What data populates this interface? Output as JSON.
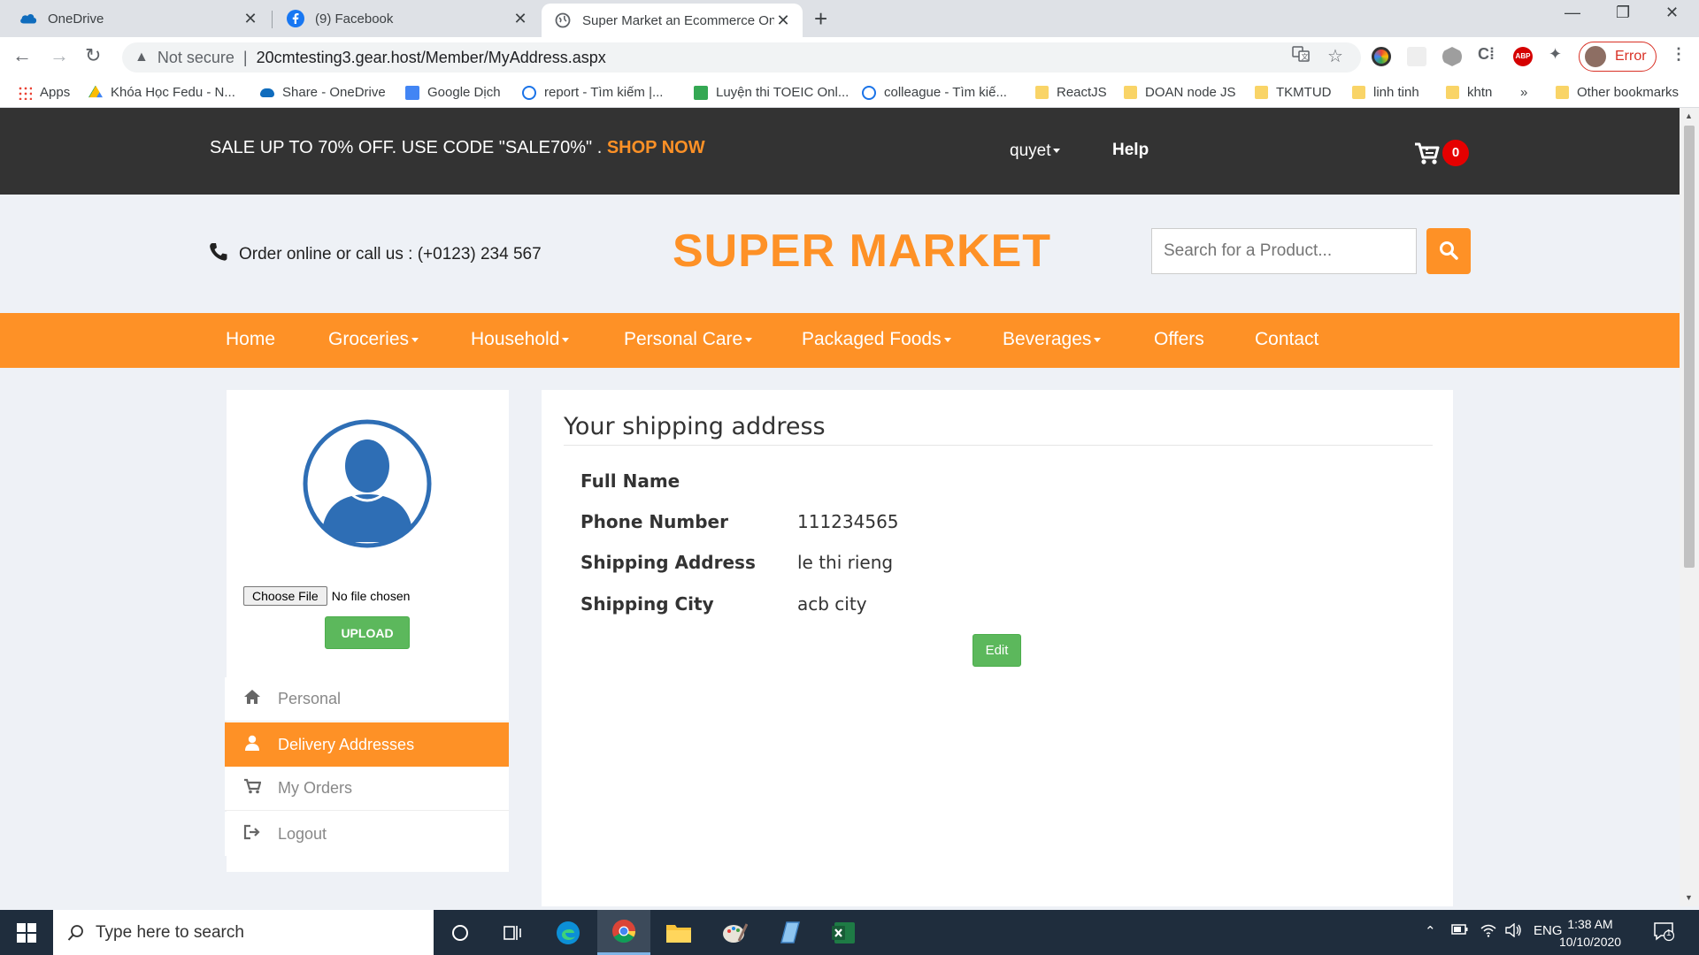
{
  "browser": {
    "tabs": [
      {
        "title": "OneDrive",
        "icon": "onedrive-cloud-icon"
      },
      {
        "title": "(9) Facebook",
        "icon": "facebook-icon"
      },
      {
        "title": "Super Market an Ecommerce Onl",
        "icon": "globe-icon"
      }
    ],
    "security_label": "Not secure",
    "url": "20cmtesting3.gear.host/Member/MyAddress.aspx",
    "profile_status": "Error",
    "bookmarks": [
      "Apps",
      "Khóa Học Fedu - N...",
      "Share - OneDrive",
      "Google Dịch",
      "report - Tìm kiếm |...",
      "Luyện thi TOEIC Onl...",
      "colleague - Tìm kiế...",
      "ReactJS",
      "DOAN node JS",
      "TKMTUD",
      "linh tinh",
      "khtn",
      "»",
      "Other bookmarks"
    ]
  },
  "topbar": {
    "promo_text": "SALE UP TO 70% OFF. USE CODE \"SALE70%\" . ",
    "promo_link": "SHOP NOW",
    "user": "quyet",
    "help": "Help",
    "cart_count": "0"
  },
  "brand": {
    "phone_text": "Order online or call us : (+0123) 234 567",
    "logo": "SUPER MARKET",
    "search_placeholder": "Search for a Product..."
  },
  "nav": [
    {
      "label": "Home",
      "dropdown": false
    },
    {
      "label": "Groceries",
      "dropdown": true
    },
    {
      "label": "Household",
      "dropdown": true
    },
    {
      "label": "Personal Care",
      "dropdown": true
    },
    {
      "label": "Packaged Foods",
      "dropdown": true
    },
    {
      "label": "Beverages",
      "dropdown": true
    },
    {
      "label": "Offers",
      "dropdown": false
    },
    {
      "label": "Contact",
      "dropdown": false
    }
  ],
  "sidebar": {
    "file_button": "Choose File",
    "file_status": "No file chosen",
    "upload": "UPLOAD",
    "items": [
      {
        "label": "Personal",
        "icon": "home-icon",
        "active": false
      },
      {
        "label": "Delivery Addresses",
        "icon": "user-icon",
        "active": true
      },
      {
        "label": "My Orders",
        "icon": "cart-icon",
        "active": false
      },
      {
        "label": "Logout",
        "icon": "logout-icon",
        "active": false
      }
    ]
  },
  "address": {
    "heading": "Your shipping address",
    "rows": [
      {
        "label": "Full Name",
        "value": ""
      },
      {
        "label": "Phone Number",
        "value": "111234565"
      },
      {
        "label": "Shipping Address",
        "value": "le thi rieng"
      },
      {
        "label": "Shipping City",
        "value": "acb city"
      }
    ],
    "edit": "Edit"
  },
  "taskbar": {
    "search_placeholder": "Type here to search",
    "language": "ENG",
    "time": "1:38 AM",
    "date": "10/10/2020",
    "notification_count": "1"
  },
  "colors": {
    "accent": "#fe9126",
    "topbar": "#333333",
    "success": "#5cb85c",
    "cart_badge": "#e60000"
  }
}
